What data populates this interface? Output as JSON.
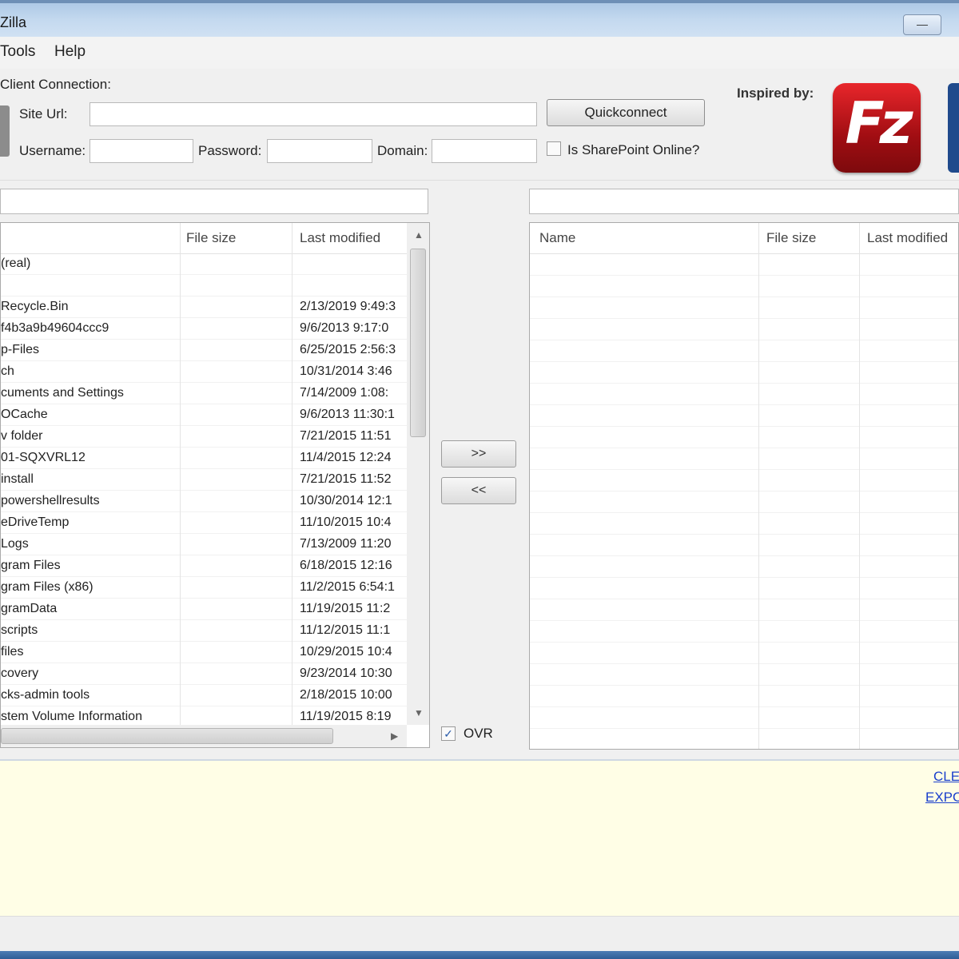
{
  "window": {
    "title": "Zilla",
    "minimize_glyph": "—"
  },
  "menu": {
    "items": [
      "Tools",
      "Help"
    ]
  },
  "connection": {
    "group_label": "Client Connection:",
    "site_url_label": "Site Url:",
    "site_url_value": "",
    "username_label": "Username:",
    "username_value": "",
    "password_label": "Password:",
    "password_value": "",
    "domain_label": "Domain:",
    "domain_value": "",
    "quickconnect_label": "Quickconnect",
    "sharepoint_online_label": "Is SharePoint Online?",
    "sharepoint_online_checked": false
  },
  "branding": {
    "inspired_label": "Inspired by:",
    "logo_text": "Fz",
    "logo_icon": "filezilla-logo-icon",
    "logo_color": "#c8151b"
  },
  "local_panel": {
    "path_value": "",
    "columns": [
      "",
      "File size",
      "Last modified"
    ],
    "rows": [
      {
        "name": "(real)",
        "size": "",
        "modified": ""
      },
      {
        "name": "",
        "size": "",
        "modified": ""
      },
      {
        "name": "Recycle.Bin",
        "size": "",
        "modified": "2/13/2019 9:49:3"
      },
      {
        "name": "f4b3a9b49604ccc9",
        "size": "",
        "modified": "9/6/2013 9:17:0"
      },
      {
        "name": "p-Files",
        "size": "",
        "modified": "6/25/2015 2:56:3"
      },
      {
        "name": "ch",
        "size": "",
        "modified": "10/31/2014 3:46"
      },
      {
        "name": "cuments and Settings",
        "size": "",
        "modified": "7/14/2009 1:08:"
      },
      {
        "name": "OCache",
        "size": "",
        "modified": "9/6/2013 11:30:1"
      },
      {
        "name": "v folder",
        "size": "",
        "modified": "7/21/2015 11:51"
      },
      {
        "name": "01-SQXVRL12",
        "size": "",
        "modified": "11/4/2015 12:24"
      },
      {
        "name": "install",
        "size": "",
        "modified": "7/21/2015 11:52"
      },
      {
        "name": "powershellresults",
        "size": "",
        "modified": "10/30/2014 12:1"
      },
      {
        "name": "eDriveTemp",
        "size": "",
        "modified": "11/10/2015 10:4"
      },
      {
        "name": "Logs",
        "size": "",
        "modified": "7/13/2009 11:20"
      },
      {
        "name": "gram Files",
        "size": "",
        "modified": "6/18/2015 12:16"
      },
      {
        "name": "gram Files (x86)",
        "size": "",
        "modified": "11/2/2015 6:54:1"
      },
      {
        "name": "gramData",
        "size": "",
        "modified": "11/19/2015 11:2"
      },
      {
        "name": "scripts",
        "size": "",
        "modified": "11/12/2015 11:1"
      },
      {
        "name": "files",
        "size": "",
        "modified": "10/29/2015 10:4"
      },
      {
        "name": "covery",
        "size": "",
        "modified": "9/23/2014 10:30"
      },
      {
        "name": "cks-admin tools",
        "size": "",
        "modified": "2/18/2015 10:00"
      },
      {
        "name": "stem Volume Information",
        "size": "",
        "modified": "11/19/2015 8:19"
      }
    ]
  },
  "transfer": {
    "upload_label": ">>",
    "download_label": "<<",
    "overwrite_label": "OVR",
    "overwrite_checked": true
  },
  "remote_panel": {
    "path_value": "",
    "columns": [
      "Name",
      "File size",
      "Last modified"
    ]
  },
  "log": {
    "clear_label": "CLE",
    "export_label": "EXPO"
  }
}
